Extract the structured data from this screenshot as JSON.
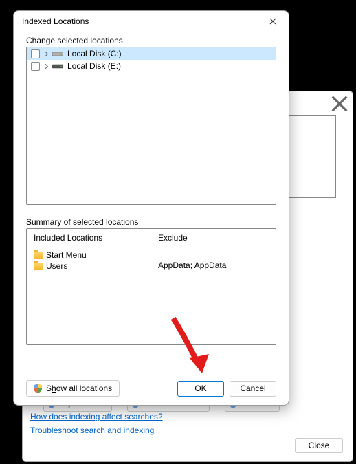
{
  "dialog": {
    "title": "Indexed Locations",
    "change_label": "Change selected locations",
    "tree": [
      {
        "label": "Local Disk (C:)",
        "selected": true
      },
      {
        "label": "Local Disk (E:)",
        "selected": false
      }
    ],
    "summary_label": "Summary of selected locations",
    "included_header": "Included Locations",
    "exclude_header": "Exclude",
    "included": [
      "Start Menu",
      "Users"
    ],
    "excluded_text": "AppData; AppData",
    "show_all_pre": "S",
    "show_all_underlined": "h",
    "show_all_post": "ow all locations",
    "ok_label": "OK",
    "cancel_label": "Cancel"
  },
  "background": {
    "links": [
      "How does indexing affect searches?",
      "Troubleshoot search and indexing"
    ],
    "close_label": "Close",
    "partial_buttons": [
      "...ify",
      "...vanced",
      "..."
    ]
  }
}
